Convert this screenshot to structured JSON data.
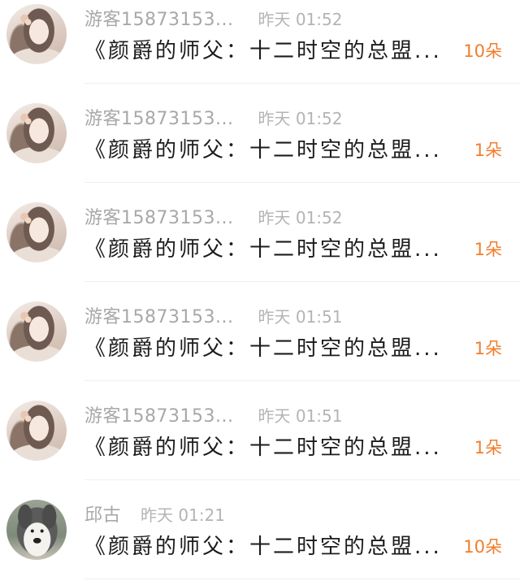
{
  "colors": {
    "accent": "#f27d2b",
    "username": "#a8a8a8",
    "title": "#1c1c1c"
  },
  "records": [
    {
      "user": "游客15873153...",
      "time": "昨天 01:52",
      "title": "《颜爵的师父：十二时空的总盟...",
      "count": "10朵",
      "avatar": "girl-avatar"
    },
    {
      "user": "游客15873153...",
      "time": "昨天 01:52",
      "title": "《颜爵的师父：十二时空的总盟...",
      "count": "1朵",
      "avatar": "girl-avatar"
    },
    {
      "user": "游客15873153...",
      "time": "昨天 01:52",
      "title": "《颜爵的师父：十二时空的总盟...",
      "count": "1朵",
      "avatar": "girl-avatar"
    },
    {
      "user": "游客15873153...",
      "time": "昨天 01:51",
      "title": "《颜爵的师父：十二时空的总盟...",
      "count": "1朵",
      "avatar": "girl-avatar"
    },
    {
      "user": "游客15873153...",
      "time": "昨天 01:51",
      "title": "《颜爵的师父：十二时空的总盟...",
      "count": "1朵",
      "avatar": "girl-avatar"
    },
    {
      "user": "邱古",
      "time": "昨天 01:21",
      "title": "《颜爵的师父：十二时空的总盟...",
      "count": "10朵",
      "avatar": "husky-avatar"
    }
  ]
}
